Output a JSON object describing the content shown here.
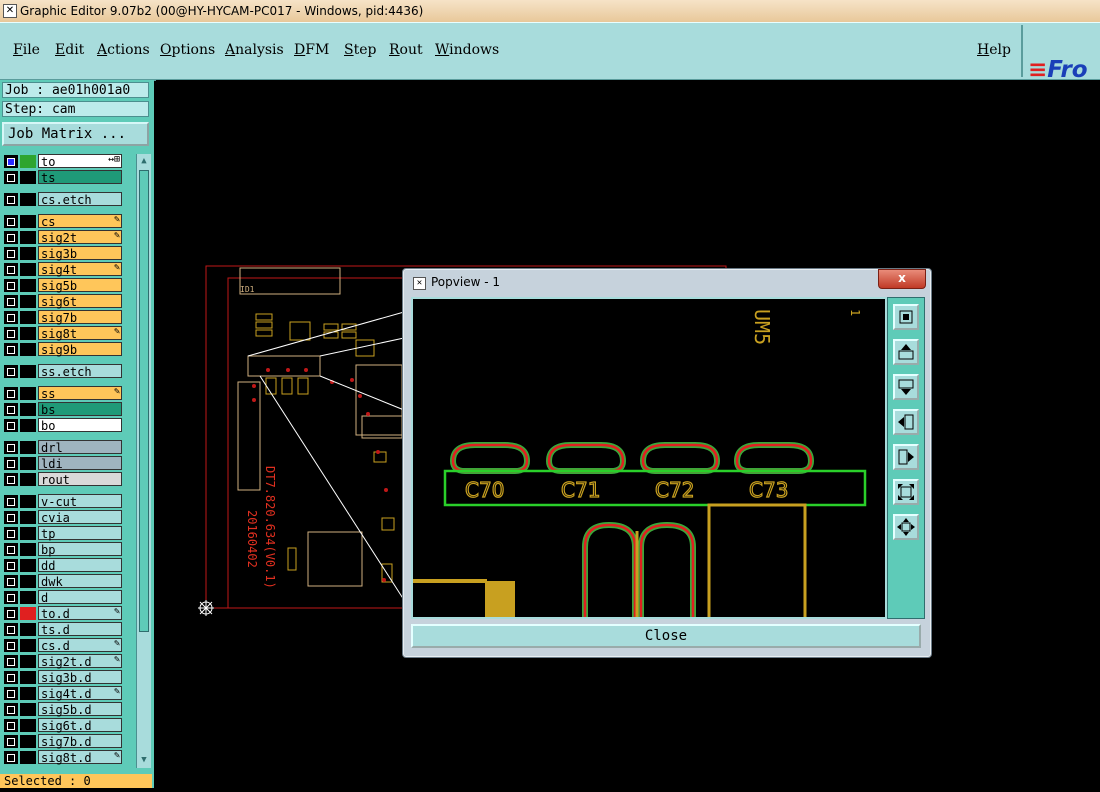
{
  "window": {
    "title": "Graphic Editor 9.07b2 (00@HY-HYCAM-PC017 - Windows, pid:4436)"
  },
  "menu": {
    "items": [
      "File",
      "Edit",
      "Actions",
      "Options",
      "Analysis",
      "DFM",
      "Step",
      "Rout",
      "Windows"
    ],
    "help": "Help",
    "logo": "Fro"
  },
  "job": {
    "job_label": "Job : ae01h001a0",
    "step_label": "Step: cam",
    "matrix_button": "Job Matrix ..."
  },
  "layers": [
    {
      "name": "to",
      "color": "#ffffff",
      "mark": "↔⊞",
      "sel": true,
      "swatch": "#2ea52e"
    },
    {
      "name": "ts",
      "color": "#1f9a78",
      "mark": ""
    },
    {
      "name": "cs.etch",
      "color": "#a8dcdc",
      "mark": ""
    },
    {
      "name": "cs",
      "color": "#ffc65a",
      "mark": "✎"
    },
    {
      "name": "sig2t",
      "color": "#ffc65a",
      "mark": "✎"
    },
    {
      "name": "sig3b",
      "color": "#ffc65a",
      "mark": ""
    },
    {
      "name": "sig4t",
      "color": "#ffc65a",
      "mark": "✎"
    },
    {
      "name": "sig5b",
      "color": "#ffc65a",
      "mark": ""
    },
    {
      "name": "sig6t",
      "color": "#ffc65a",
      "mark": ""
    },
    {
      "name": "sig7b",
      "color": "#ffc65a",
      "mark": ""
    },
    {
      "name": "sig8t",
      "color": "#ffc65a",
      "mark": "✎"
    },
    {
      "name": "sig9b",
      "color": "#ffc65a",
      "mark": ""
    },
    {
      "name": "ss.etch",
      "color": "#a8dcdc",
      "mark": ""
    },
    {
      "name": "ss",
      "color": "#ffc65a",
      "mark": "✎"
    },
    {
      "name": "bs",
      "color": "#1f9a78",
      "mark": ""
    },
    {
      "name": "bo",
      "color": "#ffffff",
      "mark": ""
    },
    {
      "name": "drl",
      "color": "#9fb4bf",
      "mark": ""
    },
    {
      "name": "ldi",
      "color": "#9fb4bf",
      "mark": ""
    },
    {
      "name": "rout",
      "color": "#d9d9d9",
      "mark": ""
    },
    {
      "name": "v-cut",
      "color": "#a8dcdc",
      "mark": ""
    },
    {
      "name": "cvia",
      "color": "#a8dcdc",
      "mark": ""
    },
    {
      "name": "tp",
      "color": "#a8dcdc",
      "mark": ""
    },
    {
      "name": "bp",
      "color": "#a8dcdc",
      "mark": ""
    },
    {
      "name": "dd",
      "color": "#a8dcdc",
      "mark": ""
    },
    {
      "name": "dwk",
      "color": "#a8dcdc",
      "mark": ""
    },
    {
      "name": "d",
      "color": "#a8dcdc",
      "mark": ""
    },
    {
      "name": "to.d",
      "color": "#a8dcdc",
      "mark": "✎",
      "swatch": "#e02020"
    },
    {
      "name": "ts.d",
      "color": "#a8dcdc",
      "mark": ""
    },
    {
      "name": "cs.d",
      "color": "#a8dcdc",
      "mark": "✎"
    },
    {
      "name": "sig2t.d",
      "color": "#a8dcdc",
      "mark": "✎"
    },
    {
      "name": "sig3b.d",
      "color": "#a8dcdc",
      "mark": ""
    },
    {
      "name": "sig4t.d",
      "color": "#a8dcdc",
      "mark": "✎"
    },
    {
      "name": "sig5b.d",
      "color": "#a8dcdc",
      "mark": ""
    },
    {
      "name": "sig6t.d",
      "color": "#a8dcdc",
      "mark": ""
    },
    {
      "name": "sig7b.d",
      "color": "#a8dcdc",
      "mark": ""
    },
    {
      "name": "sig8t.d",
      "color": "#a8dcdc",
      "mark": "✎"
    }
  ],
  "status": {
    "selected": "Selected : 0"
  },
  "popview": {
    "title": "Popview - 1",
    "close_x": "x",
    "close_button": "Close",
    "labels": [
      "C70",
      "C71",
      "C72",
      "C73"
    ],
    "ref_text": "UM5",
    "corner_text": "1",
    "tools": [
      "zoom-fit-icon",
      "pan-up-icon",
      "pan-down-icon",
      "pan-left-icon",
      "pan-right-icon",
      "zoom-in-icon",
      "zoom-out-icon"
    ]
  },
  "board": {
    "text_line1": "DT7.820.634(V0.1)",
    "text_line2": "20160402",
    "id_text": "ID1"
  },
  "colors": {
    "panel": "#5ecbb8",
    "menu": "#a8dcdc",
    "copper": "#c8a020",
    "pad_red": "#e02020",
    "pad_green": "#3aa83a",
    "outline_red": "#c01818"
  }
}
